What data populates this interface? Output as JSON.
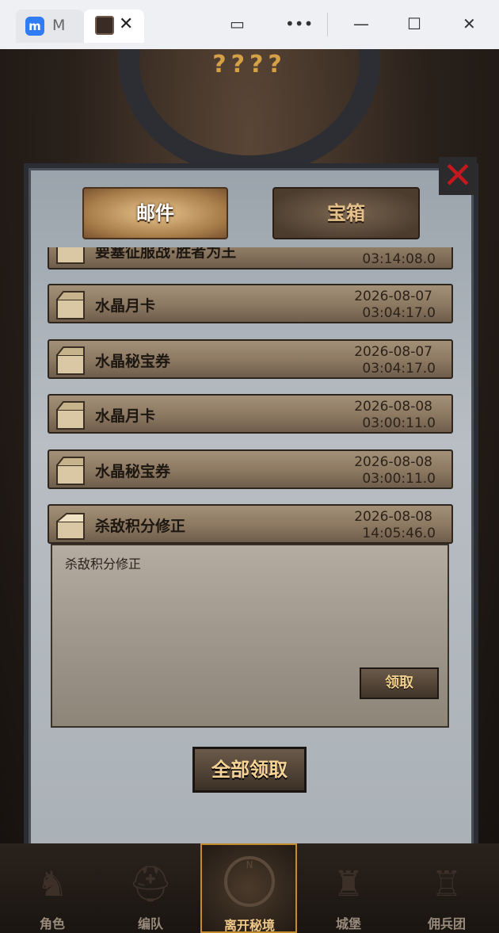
{
  "window": {
    "tab1_label": "M",
    "tab1_icon": "app-icon",
    "tab2_icon": "game-icon"
  },
  "game": {
    "header_text": "????",
    "tabs": [
      {
        "label": "邮件",
        "active": true
      },
      {
        "label": "宝箱",
        "active": false
      }
    ],
    "mails": [
      {
        "title": "要塞征服战·胜者为王",
        "date": "",
        "time": "03:14:08.0"
      },
      {
        "title": "水晶月卡",
        "date": "2026-08-07",
        "time": "03:04:17.0"
      },
      {
        "title": "水晶秘宝券",
        "date": "2026-08-07",
        "time": "03:04:17.0"
      },
      {
        "title": "水晶月卡",
        "date": "2026-08-08",
        "time": "03:00:11.0"
      },
      {
        "title": "水晶秘宝券",
        "date": "2026-08-08",
        "time": "03:00:11.0"
      },
      {
        "title": "杀敌积分修正",
        "date": "2026-08-08",
        "time": "14:05:46.0"
      }
    ],
    "detail": {
      "body": "杀敌积分修正",
      "claim_label": "领取"
    },
    "claim_all_label": "全部领取",
    "nav": [
      {
        "label": "角色",
        "icon": "knight-icon"
      },
      {
        "label": "编队",
        "icon": "helmet-icon"
      },
      {
        "label": "离开秘境",
        "icon": "compass-icon",
        "active": true
      },
      {
        "label": "城堡",
        "icon": "castle-icon"
      },
      {
        "label": "佣兵团",
        "icon": "tower-icon"
      }
    ],
    "compass_letter": "N"
  }
}
